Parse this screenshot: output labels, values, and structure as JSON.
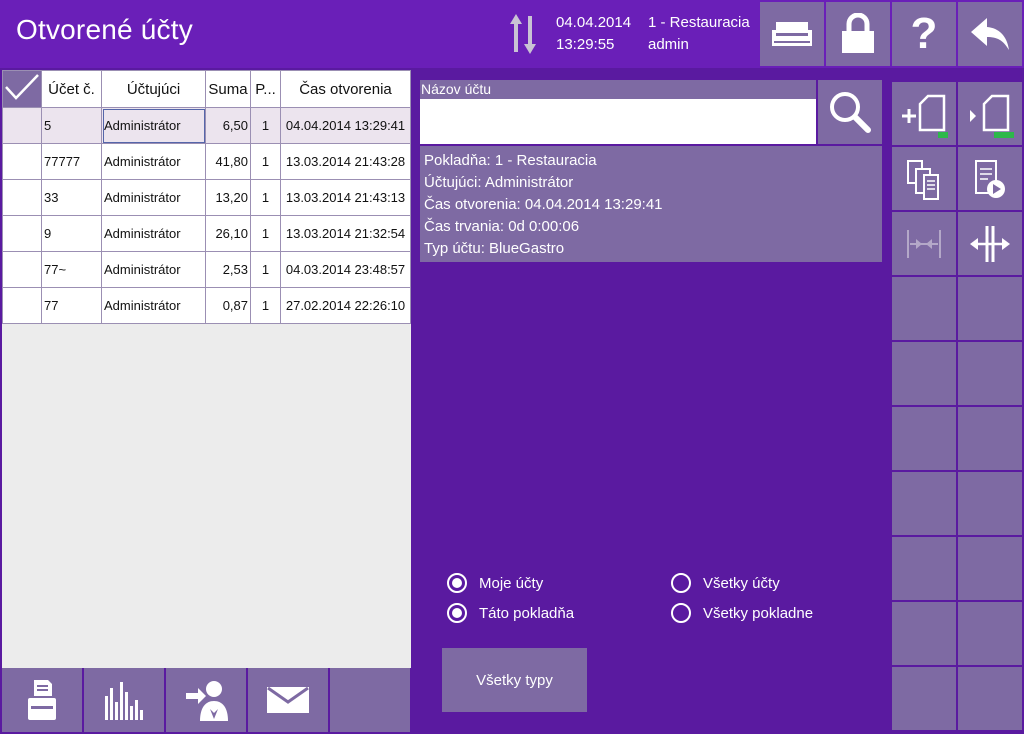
{
  "header": {
    "title": "Otvorené účty",
    "date": "04.04.2014",
    "time": "13:29:55",
    "register": "1 - Restauracia",
    "user": "admin",
    "icons": [
      "printer-icon",
      "lock-icon",
      "help-icon",
      "back-icon"
    ]
  },
  "table": {
    "columns": [
      "Účet č.",
      "Účtujúci",
      "Suma",
      "P...",
      "Čas otvorenia"
    ],
    "rows": [
      {
        "num": "5",
        "owner": "Administrátor",
        "sum": "6,50",
        "p": "1",
        "opened": "04.04.2014 13:29:41"
      },
      {
        "num": "77777",
        "owner": "Administrátor",
        "sum": "41,80",
        "p": "1",
        "opened": "13.03.2014 21:43:28"
      },
      {
        "num": "33",
        "owner": "Administrátor",
        "sum": "13,20",
        "p": "1",
        "opened": "13.03.2014 21:43:13"
      },
      {
        "num": "9",
        "owner": "Administrátor",
        "sum": "26,10",
        "p": "1",
        "opened": "13.03.2014 21:32:54"
      },
      {
        "num": "77~",
        "owner": "Administrátor",
        "sum": "2,53",
        "p": "1",
        "opened": "04.03.2014 23:48:57"
      },
      {
        "num": "77",
        "owner": "Administrátor",
        "sum": "0,87",
        "p": "1",
        "opened": "27.02.2014 22:26:10"
      }
    ]
  },
  "search": {
    "label": "Názov účtu",
    "value": "",
    "placeholder": ""
  },
  "info": {
    "register": "Pokladňa: 1 - Restauracia",
    "cashier": "Účtujúci: Administrátor",
    "opened": "Čas otvorenia: 04.04.2014 13:29:41",
    "duration": "Čas trvania: 0d 0:00:06",
    "type": "Typ účtu: BlueGastro"
  },
  "filters": {
    "my_accounts": "Moje účty",
    "all_accounts": "Všetky účty",
    "this_register": "Táto pokladňa",
    "all_registers": "Všetky pokladne"
  },
  "types_button": "Všetky typy",
  "colors": {
    "background": "#5a1aa0",
    "header": "#6a1fb8",
    "button": "#7e6aa3",
    "accent_green": "#2db84a"
  }
}
